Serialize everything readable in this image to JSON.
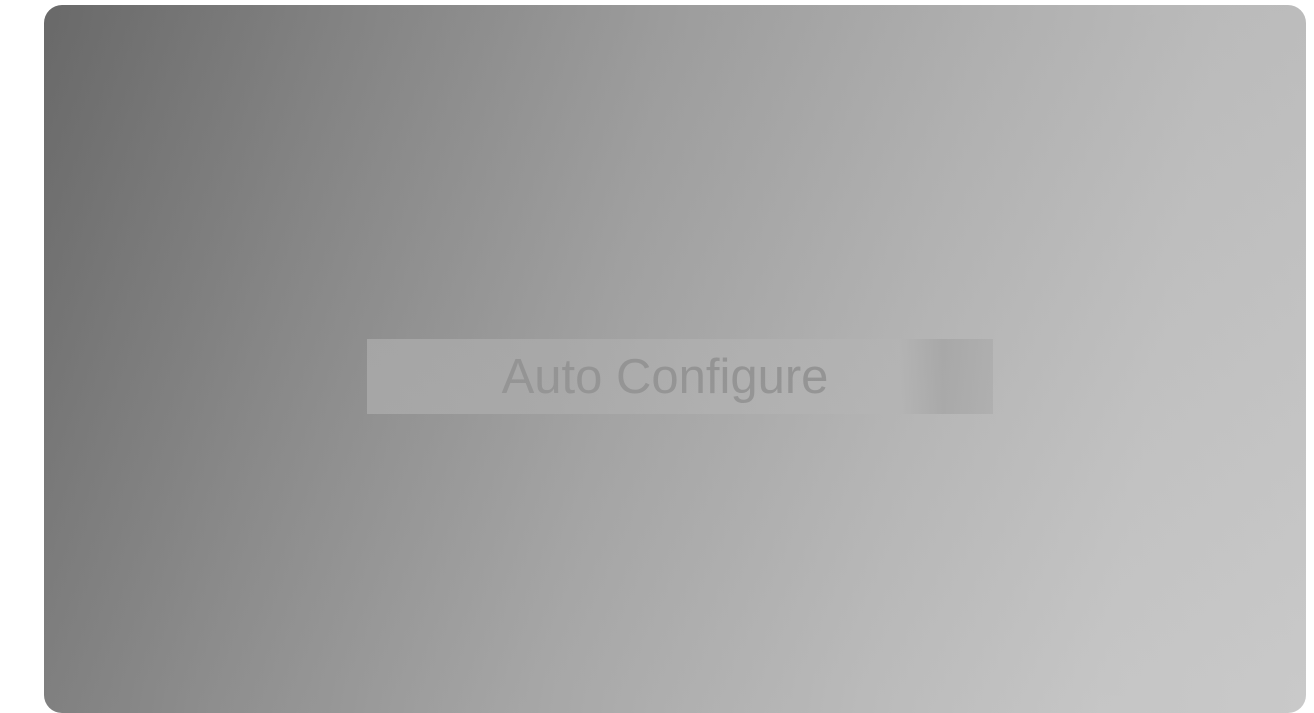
{
  "osd": {
    "message": "Auto Configure"
  },
  "colors": {
    "background": "#ffffff",
    "screen_gradient_start": "#6d6d6d",
    "screen_gradient_end": "#c6c6c6",
    "bar": "#b0b0b0",
    "label": "#949494"
  }
}
